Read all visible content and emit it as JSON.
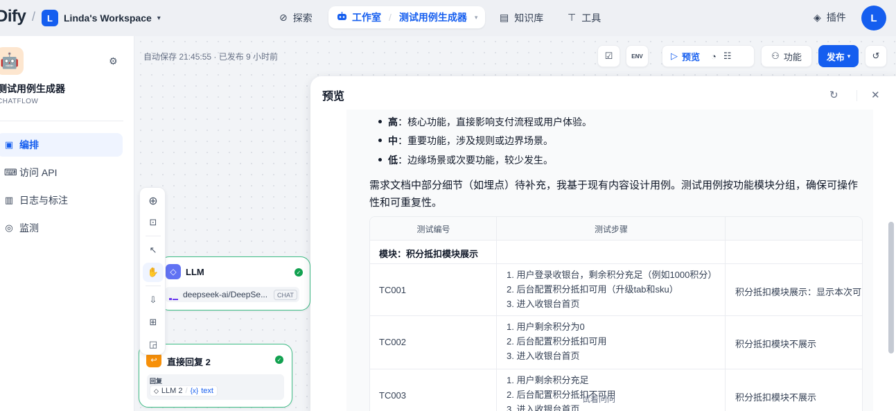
{
  "topbar": {
    "logo": "Dify",
    "workspace_initial": "L",
    "workspace_name": "Linda's Workspace",
    "nav": {
      "explore": "探索",
      "studio": "工作室",
      "current_app": "测试用例生成器",
      "knowledge": "知识库",
      "tools": "工具"
    },
    "plugins": "插件",
    "user_initial": "L"
  },
  "sidebar": {
    "app_name": "测试用例生成器",
    "app_type": "CHATFLOW",
    "items": [
      {
        "label": "编排",
        "icon": "layout-icon"
      },
      {
        "label": "访问 API",
        "icon": "terminal-icon"
      },
      {
        "label": "日志与标注",
        "icon": "log-icon"
      },
      {
        "label": "监测",
        "icon": "monitor-icon"
      }
    ]
  },
  "canvas": {
    "autosave": "自动保存 21:45:55 · 已发布 9 小时前",
    "toolbar": {
      "preview": "预览",
      "features": "功能",
      "publish": "发布"
    },
    "nodes": {
      "llm": {
        "title": "LLM",
        "model": "deepseek-ai/DeepSe...",
        "mode_tag": "CHAT"
      },
      "reply": {
        "title": "直接回复 2",
        "field_label": "回复",
        "var_source": "LLM 2",
        "var_name": "text",
        "var_prefix": "{x}"
      }
    }
  },
  "preview": {
    "title": "预览",
    "bullets": [
      {
        "level": "高",
        "text": "：核心功能，直接影响支付流程或用户体验。"
      },
      {
        "level": "中",
        "text": "：重要功能，涉及规则或边界场景。"
      },
      {
        "level": "低",
        "text": "：边缘场景或次要功能，较少发生。"
      }
    ],
    "paragraph": "需求文档中部分细节（如埋点）待补充，我基于现有内容设计用例。测试用例按功能模块分组，确保可操作性和可重复性。",
    "table": {
      "headers": [
        "测试编号",
        "测试步骤",
        ""
      ],
      "module_row": "模块：积分抵扣模块展示",
      "rows": [
        {
          "id": "TC001",
          "steps": [
            "1. 用户登录收银台，剩余积分充足（例如1000积分）",
            "2. 后台配置积分抵扣可用（升级tab和sku）",
            "3. 进入收银台首页"
          ],
          "result": "积分抵扣模块展示：显示本次可"
        },
        {
          "id": "TC002",
          "steps": [
            "1. 用户剩余积分为0",
            "2. 后台配置积分抵扣可用",
            "3. 进入收银台首页"
          ],
          "result": "积分抵扣模块不展示"
        },
        {
          "id": "TC003",
          "steps": [
            "1. 用户剩余积分充足",
            "2. 后台配置积分抵扣不可用",
            "3. 进入收银台首页"
          ],
          "result": "积分抵扣模块不展示"
        }
      ]
    },
    "ask_button": "试着问问"
  },
  "colors": {
    "accent": "#155eef",
    "node_border": "#3ebd86",
    "success": "#12a150"
  }
}
